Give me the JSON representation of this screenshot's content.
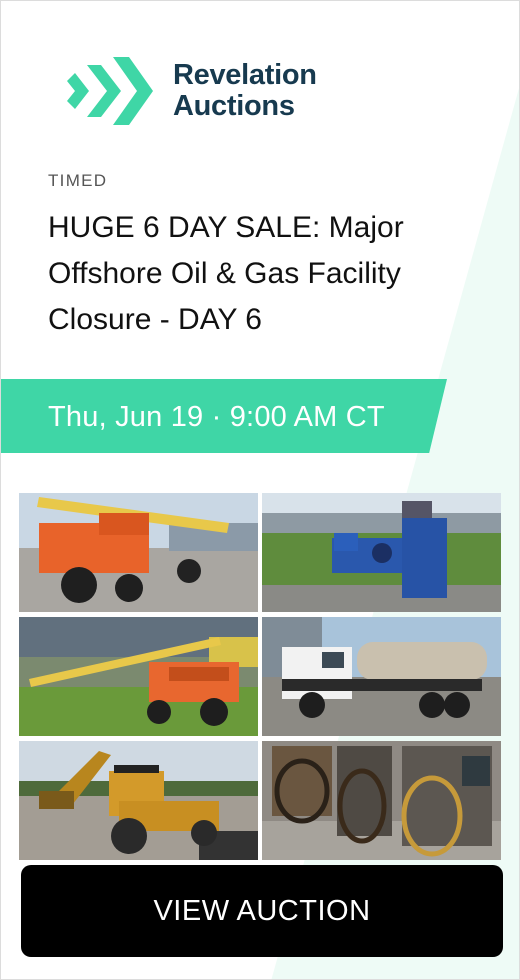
{
  "brand": {
    "line1": "Revelation",
    "line2": "Auctions",
    "accent": "#3fd6a6",
    "navy": "#173a4f"
  },
  "auction": {
    "kind": "TIMED",
    "title": "HUGE 6 DAY SALE: Major Offshore Oil & Gas Facility Closure - DAY 6",
    "date": "Thu, Jun 19 · 9:00 AM CT"
  },
  "photos": [
    "orange-boom-lift",
    "blue-pump-unit",
    "orange-boom-lift-extended",
    "white-tanker-truck",
    "yellow-backhoe-loader",
    "welding-cable-machines"
  ],
  "cta": {
    "label": "VIEW AUCTION"
  }
}
